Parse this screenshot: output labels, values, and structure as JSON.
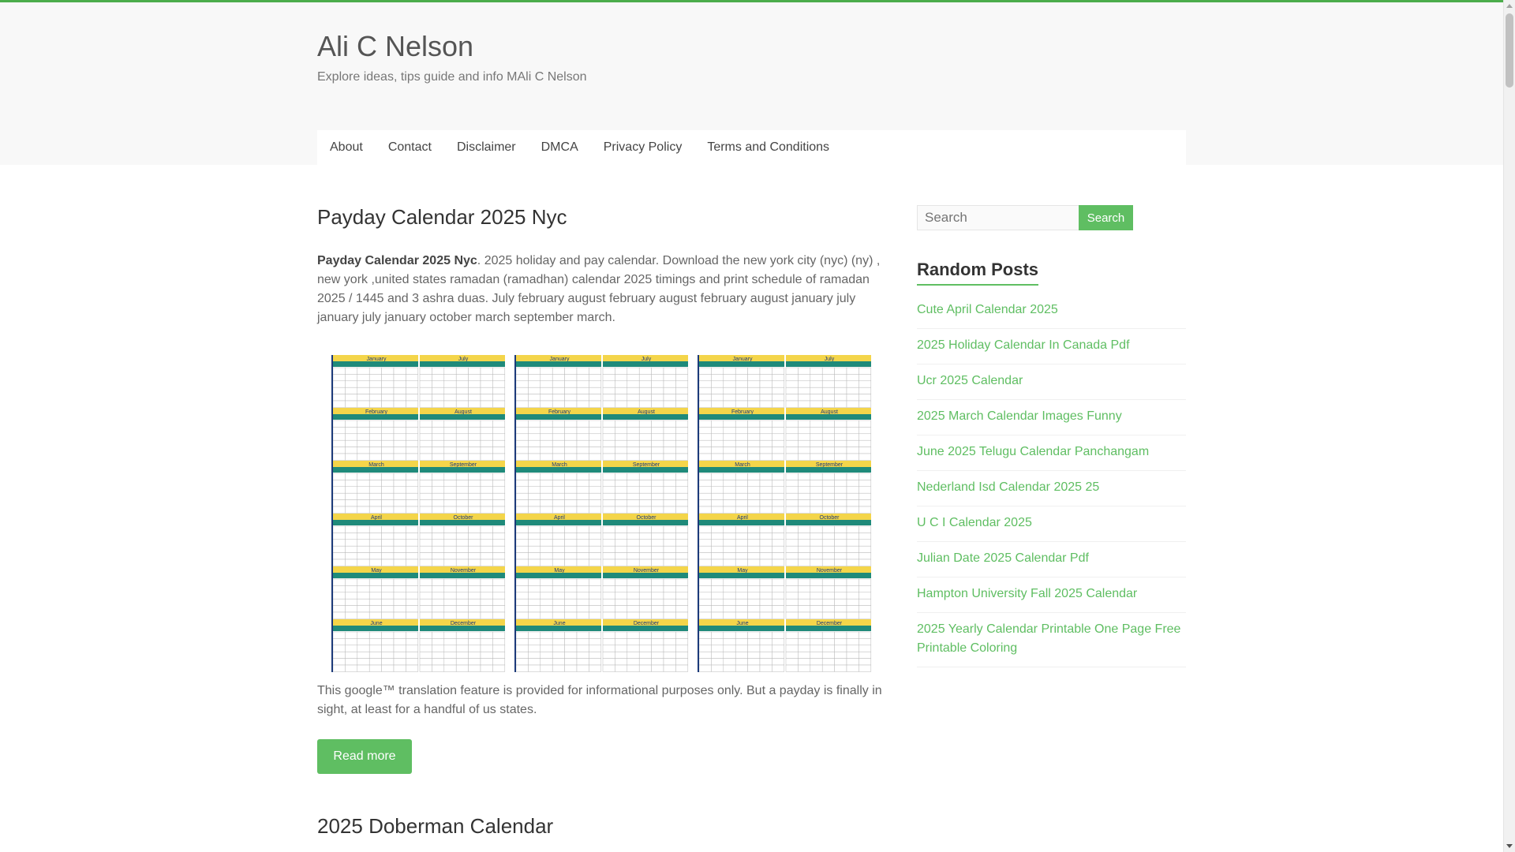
{
  "site": {
    "title": "Ali C Nelson",
    "description": "Explore ideas, tips guide and info MAli C Nelson"
  },
  "nav": {
    "items": [
      "About",
      "Contact",
      "Disclaimer",
      "DMCA",
      "Privacy Policy",
      "Terms and Conditions"
    ]
  },
  "posts": [
    {
      "title": "Payday Calendar 2025 Nyc",
      "excerpt_bold": "Payday Calendar 2025 Nyc",
      "excerpt_rest": ". 2025 holiday and pay calendar. Download the new york city (nyc) (ny) , new york ,united states ramadan (ramadhan) calendar 2025 timings and print schedule of ramadan 2025 / 1445 and 3 ashra duas. July february august february august february august january july january july january october march september march.",
      "excerpt_after": "This google™ translation feature is provided for informational purposes only. But a payday is finally in sight, at least for a handful of us states.",
      "read_more": "Read more",
      "image_months": [
        [
          "January",
          "July"
        ],
        [
          "February",
          "August"
        ],
        [
          "March",
          "September"
        ],
        [
          "April",
          "October"
        ],
        [
          "May",
          "November"
        ],
        [
          "June",
          "December"
        ]
      ]
    },
    {
      "title": "2025 Doberman Calendar"
    }
  ],
  "sidebar": {
    "search": {
      "placeholder": "Search",
      "button": "Search"
    },
    "random_posts": {
      "title": "Random Posts",
      "items": [
        "Cute April Calendar 2025",
        "2025 Holiday Calendar In Canada Pdf",
        "Ucr 2025 Calendar",
        "2025 March Calendar Images Funny",
        "June 2025 Telugu Calendar Panchangam",
        "Nederland Isd Calendar 2025 25",
        "U C I Calendar 2025",
        "Julian Date 2025 Calendar Pdf",
        "Hampton University Fall 2025 Calendar",
        "2025 Yearly Calendar Printable One Page Free Printable Coloring"
      ]
    }
  },
  "colors": {
    "accent": "#5fbe62",
    "top_border": "#4cad4c"
  }
}
